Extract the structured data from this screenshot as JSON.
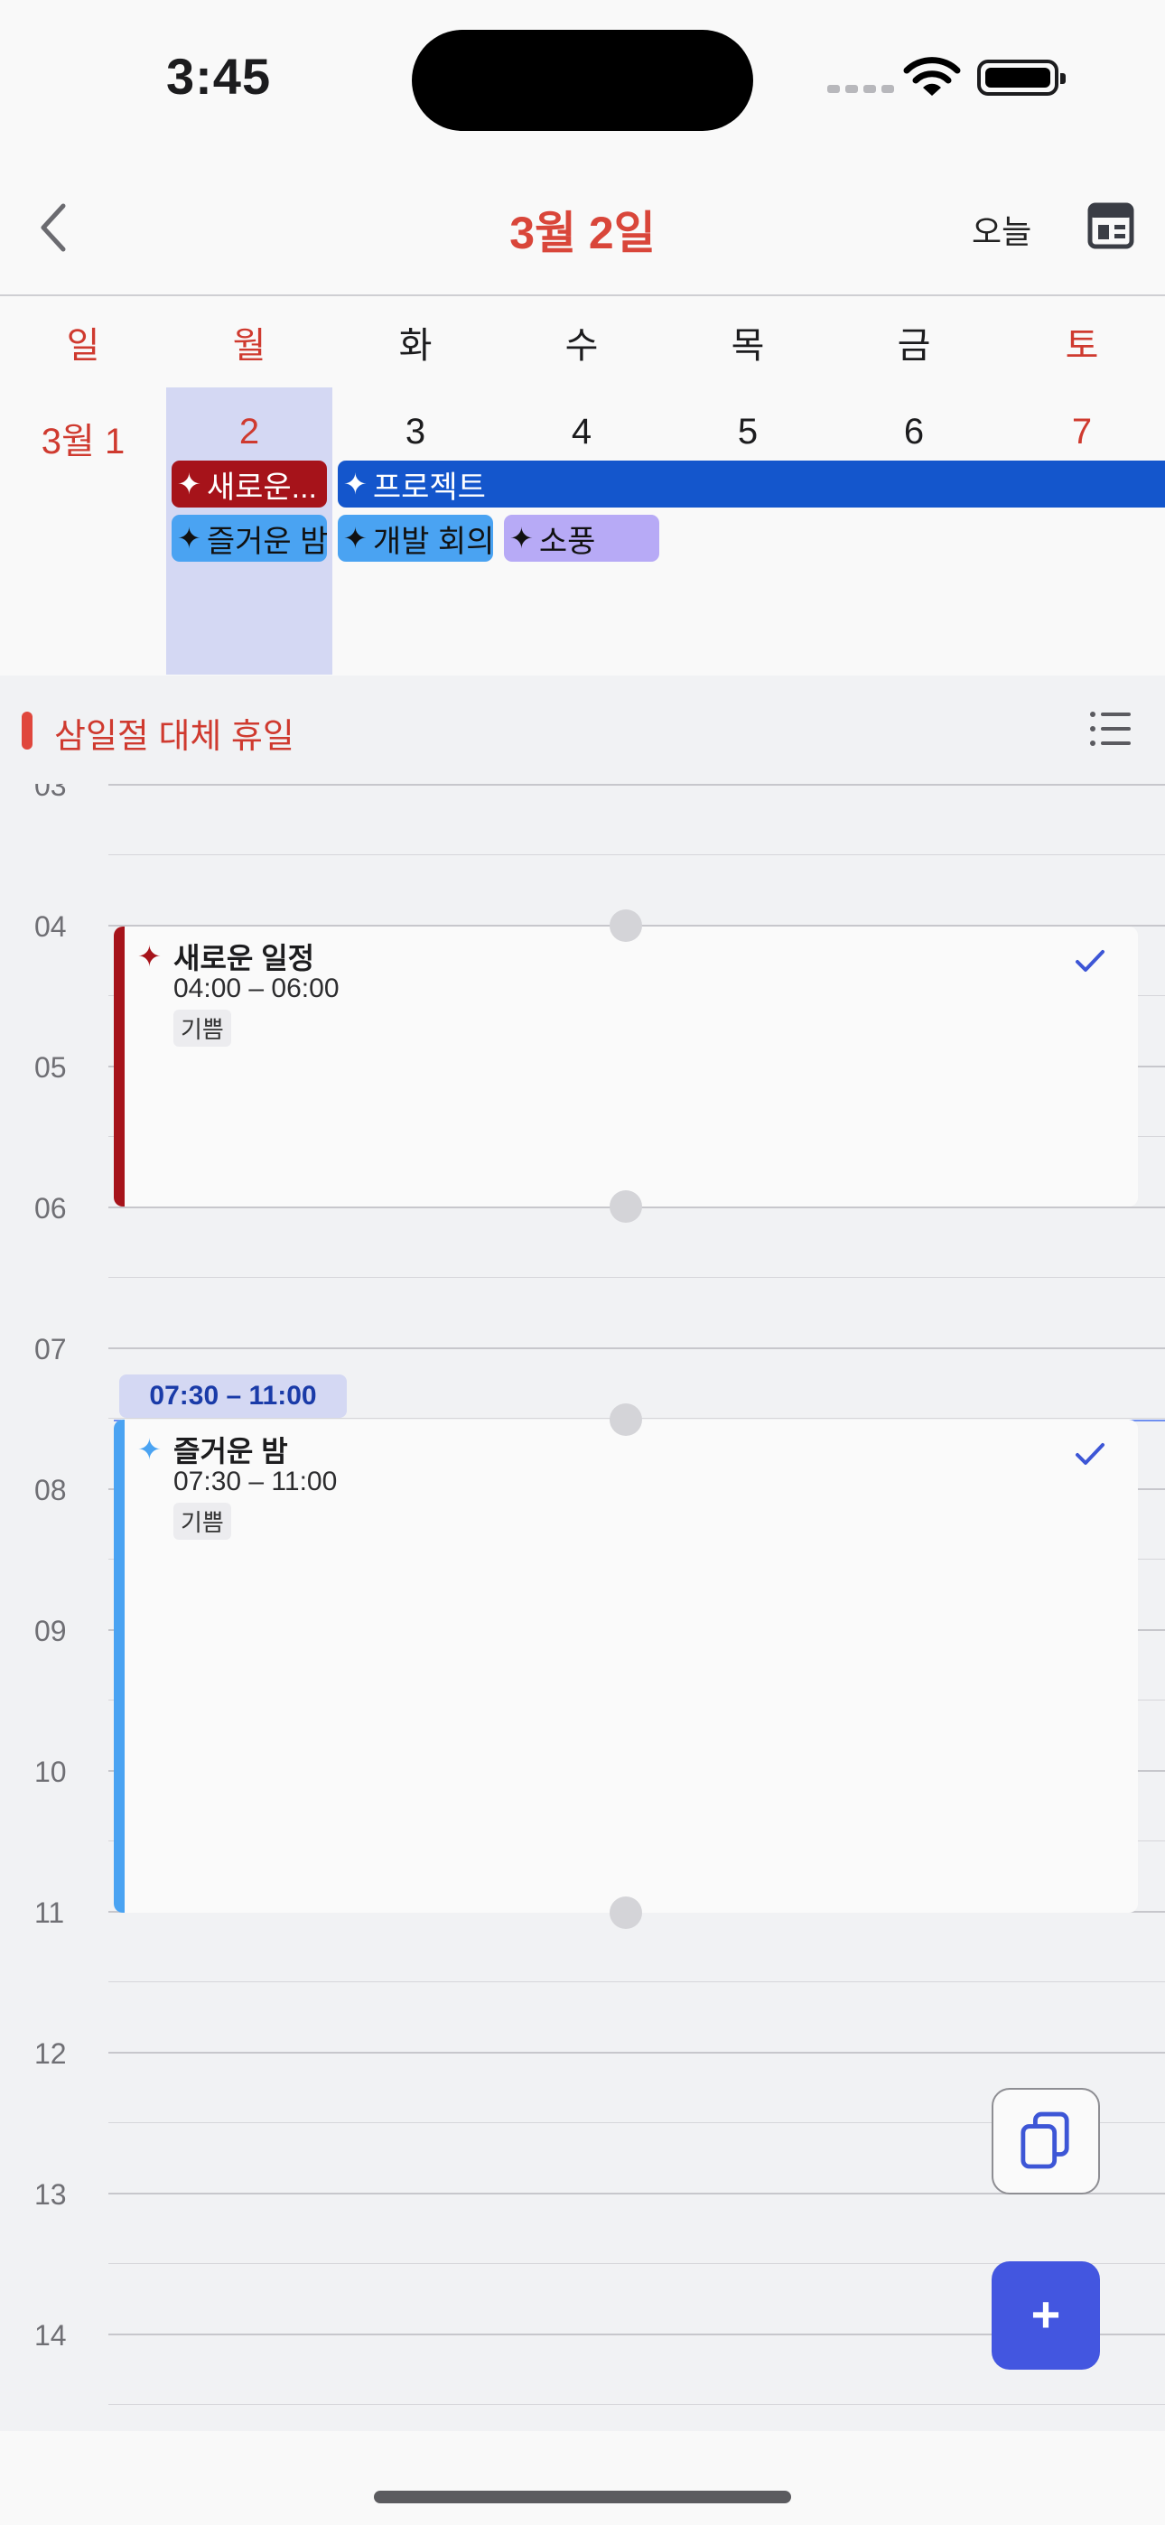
{
  "status": {
    "time": "3:45"
  },
  "nav": {
    "title": "3월 2일",
    "today": "오늘"
  },
  "week": {
    "weekdays": [
      "일",
      "월",
      "화",
      "수",
      "목",
      "금",
      "토"
    ],
    "dates": [
      "3월 1",
      "2",
      "3",
      "4",
      "5",
      "6",
      "7"
    ],
    "events": [
      {
        "label": "새로운...",
        "color": "#a6131a"
      },
      {
        "label": "프로젝트",
        "color": "#1456cc"
      },
      {
        "label": "즐거운 밤",
        "color": "#4aa3f2"
      },
      {
        "label": "개발 회의",
        "color": "#4aa3f2"
      },
      {
        "label": "소풍",
        "color": "#b7aaf6"
      }
    ]
  },
  "allday": {
    "label": "삼일절 대체 휴일"
  },
  "timeline": {
    "hours": [
      "03",
      "04",
      "05",
      "06",
      "07",
      "08",
      "09",
      "10",
      "11",
      "12",
      "13",
      "14"
    ],
    "events": [
      {
        "title": "새로운 일정",
        "time": "04:00 – 06:00",
        "tag": "기쁨",
        "color": "#a6131a",
        "completed": true
      },
      {
        "title": "즐거운 밤",
        "time": "07:30 – 11:00",
        "tag": "기쁨",
        "color": "#4aa3f2",
        "completed": true
      }
    ],
    "drag_badge": "07:30 – 11:00"
  },
  "fab": {
    "add_label": "+"
  },
  "icons": [
    "back-chevron-icon",
    "layout-icon",
    "list-icon",
    "copy-icon",
    "checkmark-icon",
    "sparkle-icon",
    "wifi-icon",
    "battery-icon"
  ]
}
